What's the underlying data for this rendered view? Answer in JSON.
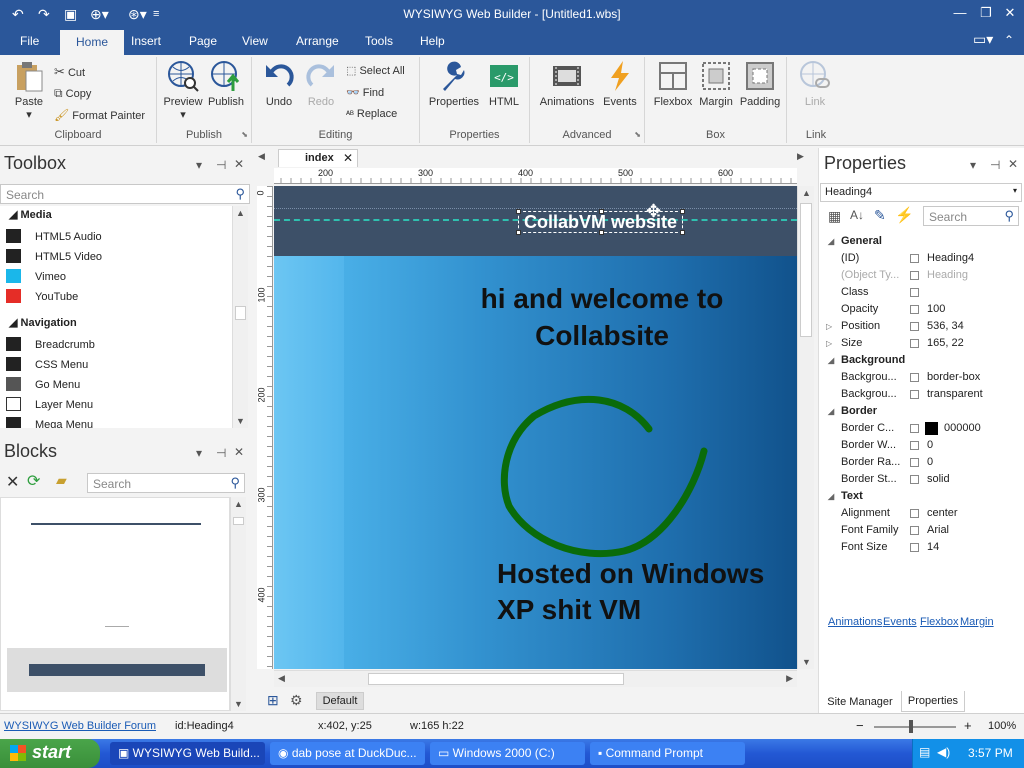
{
  "titlebar": {
    "title": "WYSIWYG Web Builder - [Untitled1.wbs]"
  },
  "menu_tabs": [
    "File",
    "Home",
    "Insert",
    "Page",
    "View",
    "Arrange",
    "Tools",
    "Help"
  ],
  "ribbon": {
    "paste": "Paste",
    "cut": "Cut",
    "copy": "Copy",
    "format_painter": "Format Painter",
    "clipboard": "Clipboard",
    "preview": "Preview",
    "publish_btn": "Publish",
    "publish": "Publish",
    "undo": "Undo",
    "redo": "Redo",
    "select_all": "Select All",
    "find": "Find",
    "replace": "Replace",
    "editing": "Editing",
    "properties_btn": "Properties",
    "html": "HTML",
    "properties": "Properties",
    "animations": "Animations",
    "events": "Events",
    "advanced": "Advanced",
    "flexbox": "Flexbox",
    "margin": "Margin",
    "padding": "Padding",
    "box": "Box",
    "link_btn": "Link",
    "link": "Link"
  },
  "toolbox": {
    "title": "Toolbox",
    "search": "Search",
    "categories": [
      "Media",
      "Navigation"
    ],
    "media": [
      "HTML5 Audio",
      "HTML5 Video",
      "Vimeo",
      "YouTube"
    ],
    "navigation": [
      "Breadcrumb",
      "CSS Menu",
      "Go Menu",
      "Layer Menu",
      "Mega Menu"
    ]
  },
  "blocks": {
    "title": "Blocks",
    "search": "Search"
  },
  "editor": {
    "tab": "index",
    "ruler_top": [
      "200",
      "300",
      "400",
      "500",
      "600"
    ],
    "ruler_left": [
      "0",
      "100",
      "200",
      "300",
      "400"
    ],
    "heading": "CollabVM website",
    "welcome": "hi and welcome to Collabsite",
    "hosted": "Hosted on Windows XP shit VM",
    "default_btn": "Default"
  },
  "properties": {
    "title": "Properties",
    "selected": "Heading4",
    "search": "Search",
    "sections": {
      "general": "General",
      "background": "Background",
      "border": "Border",
      "text": "Text"
    },
    "general": [
      {
        "name": "(ID)",
        "value": "Heading4"
      },
      {
        "name": "(Object Ty...",
        "value": "Heading"
      },
      {
        "name": "Class",
        "value": ""
      },
      {
        "name": "Opacity",
        "value": "100"
      },
      {
        "name": "Position",
        "value": "536, 34"
      },
      {
        "name": "Size",
        "value": "165, 22"
      }
    ],
    "background": [
      {
        "name": "Backgrou...",
        "value": "border-box"
      },
      {
        "name": "Backgrou...",
        "value": "transparent"
      }
    ],
    "border": [
      {
        "name": "Border C...",
        "value": "000000"
      },
      {
        "name": "Border W...",
        "value": "0"
      },
      {
        "name": "Border Ra...",
        "value": "0"
      },
      {
        "name": "Border St...",
        "value": "solid"
      }
    ],
    "text": [
      {
        "name": "Alignment",
        "value": "center"
      },
      {
        "name": "Font Family",
        "value": "Arial"
      },
      {
        "name": "Font Size",
        "value": "14"
      }
    ],
    "links": [
      "Animations",
      "Events",
      "Flexbox",
      "Margin"
    ],
    "bottom_tabs": [
      "Site Manager",
      "Properties"
    ]
  },
  "statusbar": {
    "forum": "WYSIWYG Web Builder Forum",
    "id": "id:Heading4",
    "coords": "x:402, y:25",
    "size": "w:165 h:22",
    "zoom": "100%"
  },
  "taskbar": {
    "start": "start",
    "tasks": [
      "WYSIWYG Web Build...",
      "dab pose at DuckDuc...",
      "Windows 2000 (C:)",
      "Command Prompt"
    ],
    "time": "3:57 PM"
  },
  "colors": {
    "accent": "#2b579a",
    "taskbar": "#245edb",
    "circle": "#0a6b0a",
    "selection": "#00c0c0"
  }
}
